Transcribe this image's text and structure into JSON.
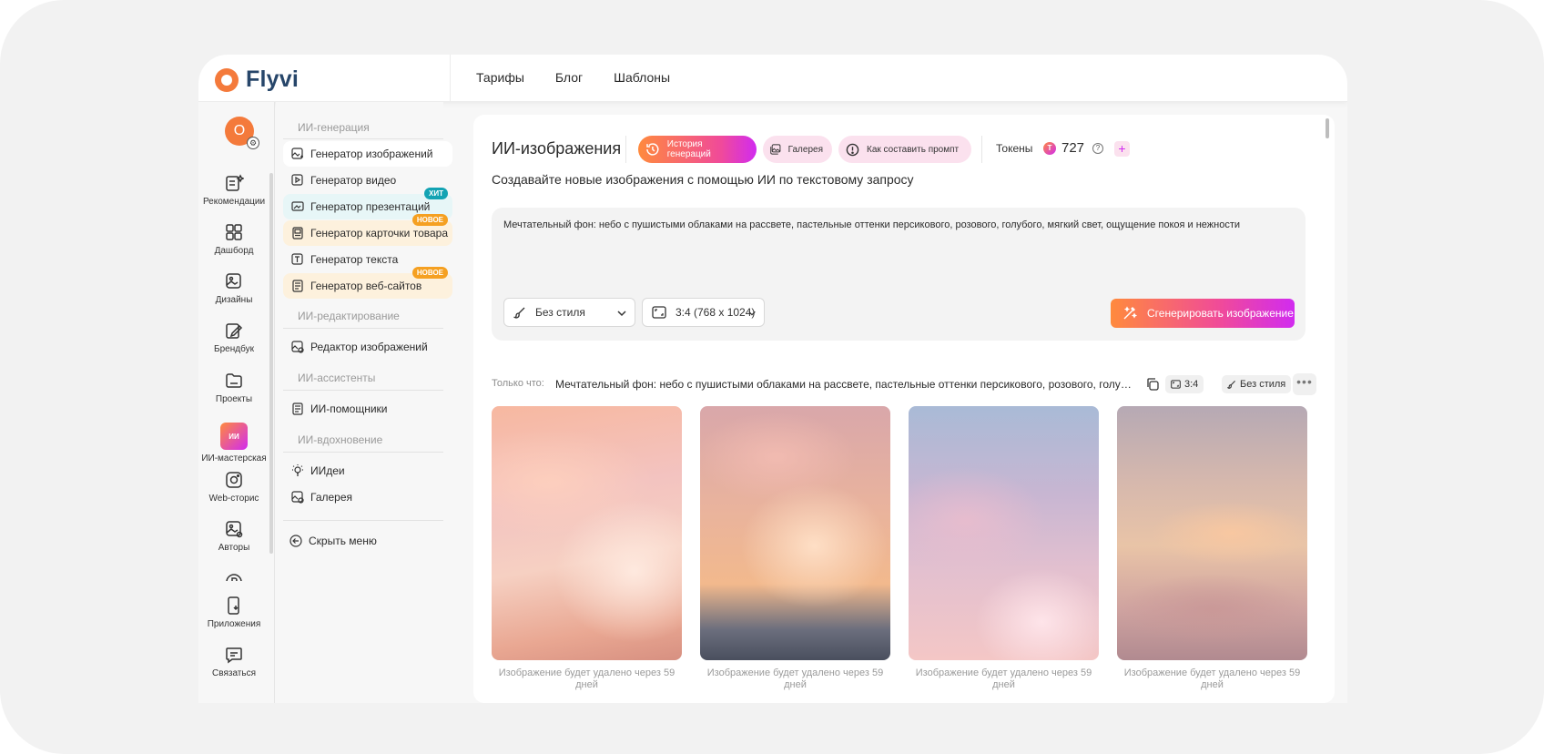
{
  "app": {
    "logo_text": "Flyvi",
    "brand_color": "#f47a3b"
  },
  "nav": {
    "items": [
      "Тарифы",
      "Блог",
      "Шаблоны"
    ]
  },
  "user": {
    "avatar_letter": "O"
  },
  "rail": {
    "items": [
      {
        "label": "Рекомендации",
        "icon": "recommendations-icon"
      },
      {
        "label": "Дашборд",
        "icon": "dashboard-icon"
      },
      {
        "label": "Дизайны",
        "icon": "designs-icon"
      },
      {
        "label": "Брендбук",
        "icon": "brandbook-icon"
      },
      {
        "label": "Проекты",
        "icon": "folder-icon"
      },
      {
        "label": "ИИ-мастерская",
        "icon": "ai-workshop-icon",
        "badge": "ИИ"
      },
      {
        "label": "Web-сторис",
        "icon": "instagram-icon"
      },
      {
        "label": "Авторы",
        "icon": "authors-icon"
      },
      {
        "label": "Приложения",
        "icon": "phone-icon"
      },
      {
        "label": "Связаться",
        "icon": "chat-icon"
      }
    ]
  },
  "menu": {
    "cat_generation": "ИИ-генерация",
    "gen_items": [
      {
        "label": "Генератор изображений"
      },
      {
        "label": "Генератор видео"
      },
      {
        "label": "Генератор презентаций",
        "tag": "ХИТ"
      },
      {
        "label": "Генератор карточки товара",
        "tag": "НОВОЕ"
      },
      {
        "label": "Генератор текста"
      },
      {
        "label": "Генератор веб-сайтов",
        "tag": "НОВОЕ"
      }
    ],
    "cat_editing": "ИИ-редактирование",
    "edit_items": [
      {
        "label": "Редактор изображений"
      }
    ],
    "cat_assistants": "ИИ-ассистенты",
    "assist_items": [
      {
        "label": "ИИ-помощники"
      }
    ],
    "cat_inspiration": "ИИ-вдохновение",
    "insp_items": [
      {
        "label": "ИИдеи"
      },
      {
        "label": "Галерея"
      }
    ],
    "hide_menu": "Скрыть меню"
  },
  "main": {
    "title": "ИИ-изображения",
    "tabs": {
      "history": "История генераций",
      "gallery": "Галерея",
      "how_to": "Как составить промпт"
    },
    "tokens_label": "Токены",
    "tokens_value": "727",
    "subtitle": "Создавайте новые изображения с помощью ИИ по текстовому запросу",
    "prompt": "Мечтательный фон: небо с пушистыми облаками на рассвете, пастельные оттенки персикового, розового, голубого, мягкий свет, ощущение покоя и нежности",
    "style_select": "Без стиля",
    "ratio_select": "3:4 (768 x 1024)",
    "generate_button": "Сгенерировать изображение",
    "just_now_label": "Только что:",
    "just_now_prompt": "Мечтательный фон: небо с пушистыми облаками на рассвете, пастельные оттенки персикового, розового, голубого, мягкий свет, ощущение покоя и нежности",
    "chip_ratio": "3:4",
    "chip_style": "Без стиля",
    "more": "•••",
    "images": [
      {
        "caption": "Изображение будет удалено через 59 дней"
      },
      {
        "caption": "Изображение будет удалено через 59 дней"
      },
      {
        "caption": "Изображение будет удалено через 59 дней"
      },
      {
        "caption": "Изображение будет удалено через 59 дней"
      }
    ]
  },
  "colors": {
    "accent_gradient_start": "#ff8a3d",
    "accent_gradient_end": "#d12bf0",
    "hot_tag": "#13a3b3",
    "new_tag": "#f5a021"
  }
}
